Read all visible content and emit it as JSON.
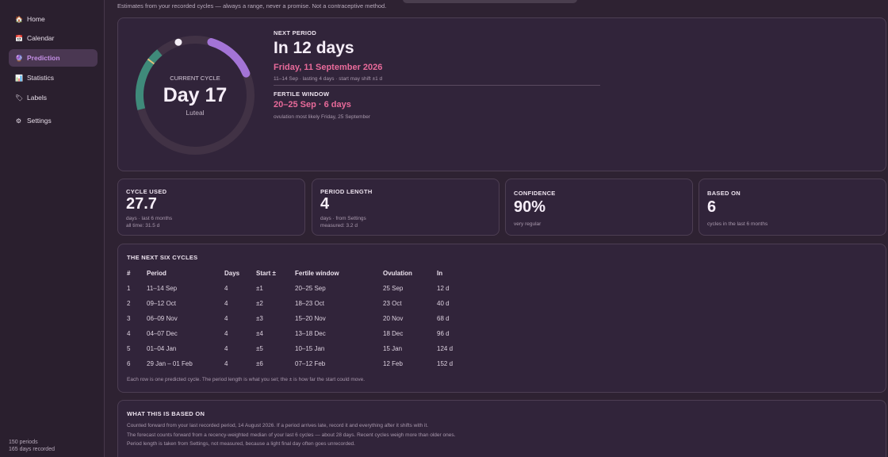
{
  "sidebar": {
    "items": [
      {
        "icon": "home-icon",
        "glyph": "🏠",
        "label": "Home"
      },
      {
        "icon": "calendar-icon",
        "glyph": "📅",
        "label": "Calendar"
      },
      {
        "icon": "crystal-ball-icon",
        "glyph": "🔮",
        "label": "Prediction"
      },
      {
        "icon": "bar-chart-icon",
        "glyph": "📊",
        "label": "Statistics"
      },
      {
        "icon": "tag-icon",
        "glyph": "🏷",
        "label": "Labels"
      },
      {
        "icon": "gear-icon",
        "glyph": "⚙",
        "label": "Settings"
      }
    ],
    "active": "Prediction",
    "footer_periods": "150 periods",
    "footer_days": "165 days recorded"
  },
  "header": {
    "subtitle": "Estimates from your recorded cycles — always a range, never a promise. Not a contraceptive method."
  },
  "hero": {
    "current_cycle_label": "CURRENT CYCLE",
    "day_text": "Day 17",
    "phase": "Luteal",
    "ring": {
      "cycle_length": 27.7,
      "current_day": 17,
      "period_days": 4,
      "fertile_start_day": 18.5,
      "fertile_end_day": 23.5,
      "ovulation_day": 22.5
    },
    "next_period_label": "NEXT PERIOD",
    "next_period_in": "In 12 days",
    "next_period_date": "Friday, 11 September 2026",
    "next_period_detail": "11–14 Sep · lasting 4 days · start may shift ±1 d",
    "fertile_label": "FERTILE WINDOW",
    "fertile_value": "20–25 Sep · 6 days",
    "fertile_detail": "ovulation most likely Friday, 25 September"
  },
  "stats": [
    {
      "label": "CYCLE USED",
      "value": "27.7",
      "sub1": "days · last 6 months",
      "sub2": "all time: 31.5 d"
    },
    {
      "label": "PERIOD LENGTH",
      "value": "4",
      "sub1": "days · from Settings",
      "sub2": "measured: 3.2 d"
    },
    {
      "label": "CONFIDENCE",
      "value": "90%",
      "sub1": "very regular",
      "sub2": ""
    },
    {
      "label": "BASED ON",
      "value": "6",
      "sub1": "cycles in the last 6 months",
      "sub2": ""
    }
  ],
  "table": {
    "title": "THE NEXT SIX CYCLES",
    "columns": [
      "#",
      "Period",
      "Days",
      "Start ±",
      "Fertile window",
      "Ovulation",
      "In"
    ],
    "rows": [
      [
        "1",
        "11–14 Sep",
        "4",
        "±1",
        "20–25 Sep",
        "25 Sep",
        "12 d"
      ],
      [
        "2",
        "09–12 Oct",
        "4",
        "±2",
        "18–23 Oct",
        "23 Oct",
        "40 d"
      ],
      [
        "3",
        "06–09 Nov",
        "4",
        "±3",
        "15–20 Nov",
        "20 Nov",
        "68 d"
      ],
      [
        "4",
        "04–07 Dec",
        "4",
        "±4",
        "13–18 Dec",
        "18 Dec",
        "96 d"
      ],
      [
        "5",
        "01–04 Jan",
        "4",
        "±5",
        "10–15 Jan",
        "15 Jan",
        "124 d"
      ],
      [
        "6",
        "29 Jan – 01 Feb",
        "4",
        "±6",
        "07–12 Feb",
        "12 Feb",
        "152 d"
      ]
    ],
    "footnote": "Each row is one predicted cycle. The period length is what you set; the ± is how far the start could move."
  },
  "basis": {
    "title": "WHAT THIS IS BASED ON",
    "lines": [
      "Counted forward from your last recorded period, 14 August 2026. If a period arrives late, record it and everything after it shifts with it.",
      "The forecast counts forward from a recency-weighted median of your last 6 cycles — about 28 days. Recent cycles weigh more than older ones.",
      "Period length is taken from Settings, not measured, because a light final day often goes unrecorded."
    ]
  },
  "colors": {
    "period": "#a374d6",
    "fertile": "#3f8a7a",
    "ovulation": "#e2c07a",
    "track": "#413245",
    "accent_pink": "#e86a9a",
    "active_nav": "#c48fe6"
  }
}
